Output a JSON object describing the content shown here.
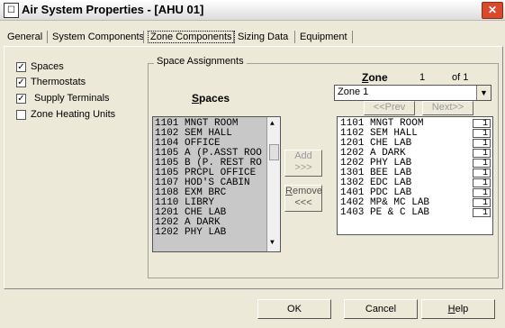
{
  "window": {
    "title": "Air System Properties - [AHU 01]",
    "close_glyph": "✕"
  },
  "tabs": [
    {
      "label": "General"
    },
    {
      "label": "System Components"
    },
    {
      "label": "Zone Components"
    },
    {
      "label": "Sizing Data"
    },
    {
      "label": "Equipment"
    }
  ],
  "active_tab": "Zone Components",
  "checkboxes": [
    {
      "label": "Spaces",
      "checked": true
    },
    {
      "label": "Thermostats",
      "checked": true
    },
    {
      "label": "Supply Terminals",
      "checked": true
    },
    {
      "label": "Zone Heating Units",
      "checked": false
    }
  ],
  "space_assignments": {
    "group_title": "Space Assignments",
    "spaces_title_underlined": "S",
    "spaces_title_rest": "paces",
    "spaces": [
      "1101 MNGT ROOM",
      "1102 SEM HALL",
      "1104 OFFICE",
      "1105 A (P.ASST ROO",
      "1105 B  (P. REST RO",
      "1105 PRCPL OFFICE",
      "1107 HOD'S CABIN",
      "1108 EXM BRC",
      "1110 LIBRY",
      "1201 CHE LAB",
      "1202 A DARK",
      "1202 PHY LAB"
    ],
    "add_label": "Add\n>>>",
    "remove_label": "Remove\n<<<",
    "remove_underline": "R",
    "remove_rest": "emove",
    "remove_arrows": "<<<",
    "add_text": "Add",
    "add_arrows": ">>>"
  },
  "zone": {
    "title_underlined": "Z",
    "title_rest": "one",
    "index": "1",
    "of_text": "of 1",
    "selected": "Zone 1",
    "prev_label": "<<Prev",
    "prev_underline": "P",
    "next_label": "Next>>",
    "assigned": [
      {
        "name": "1101 MNGT ROOM",
        "count": "1"
      },
      {
        "name": "1102 SEM HALL",
        "count": "1"
      },
      {
        "name": "1201 CHE LAB",
        "count": "1"
      },
      {
        "name": "1202 A DARK",
        "count": "1"
      },
      {
        "name": "1202 PHY LAB",
        "count": "1"
      },
      {
        "name": "1301 BEE LAB",
        "count": "1"
      },
      {
        "name": "1302 EDC LAB",
        "count": "1"
      },
      {
        "name": "1401 PDC LAB",
        "count": "1"
      },
      {
        "name": "1402 MP& MC LAB",
        "count": "1"
      },
      {
        "name": "1403 PE & C LAB",
        "count": "1"
      }
    ]
  },
  "footer": {
    "ok_label": "OK",
    "cancel_label": "Cancel",
    "help_underlined": "H",
    "help_rest": "elp"
  },
  "colors": {
    "dialog_bg": "#ece9d8",
    "close_button": "#d84a2b",
    "spaces_list_bg": "#c8c8c8"
  }
}
